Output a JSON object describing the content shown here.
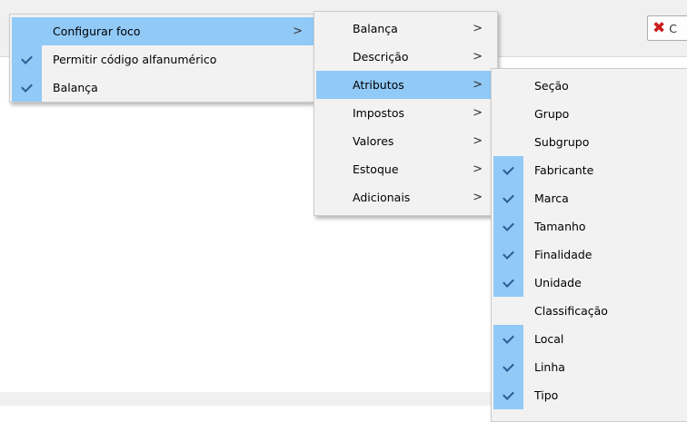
{
  "toolbar": {
    "close_button_label": "C"
  },
  "menus": {
    "main": [
      {
        "label": "Configurar foco",
        "checked": false,
        "submenu": true,
        "highlighted": true
      },
      {
        "label": "Permitir código alfanumérico",
        "checked": true,
        "submenu": false,
        "highlighted": false
      },
      {
        "label": "Balança",
        "checked": true,
        "submenu": false,
        "highlighted": false
      }
    ],
    "focus_submenu": [
      {
        "label": "Balança",
        "submenu": true,
        "highlighted": false
      },
      {
        "label": "Descrição",
        "submenu": true,
        "highlighted": false
      },
      {
        "label": "Atributos",
        "submenu": true,
        "highlighted": true
      },
      {
        "label": "Impostos",
        "submenu": true,
        "highlighted": false
      },
      {
        "label": "Valores",
        "submenu": true,
        "highlighted": false
      },
      {
        "label": "Estoque",
        "submenu": true,
        "highlighted": false
      },
      {
        "label": "Adicionais",
        "submenu": true,
        "highlighted": false
      }
    ],
    "attributes_submenu": [
      {
        "label": "Seção",
        "checked": false
      },
      {
        "label": "Grupo",
        "checked": false
      },
      {
        "label": "Subgrupo",
        "checked": false
      },
      {
        "label": "Fabricante",
        "checked": true
      },
      {
        "label": "Marca",
        "checked": true
      },
      {
        "label": "Tamanho",
        "checked": true
      },
      {
        "label": "Finalidade",
        "checked": true
      },
      {
        "label": "Unidade",
        "checked": true
      },
      {
        "label": "Classificação",
        "checked": false
      },
      {
        "label": "Local",
        "checked": true
      },
      {
        "label": "Linha",
        "checked": true
      },
      {
        "label": "Tipo",
        "checked": true
      }
    ]
  },
  "icons": {
    "check": "check-icon",
    "submenu_arrow": ">",
    "close": "✖"
  },
  "colors": {
    "menu_background": "#f2f2f2",
    "highlight": "#91c9f7",
    "check_mark": "#2c5d94",
    "close_icon": "#cc1d1d"
  }
}
